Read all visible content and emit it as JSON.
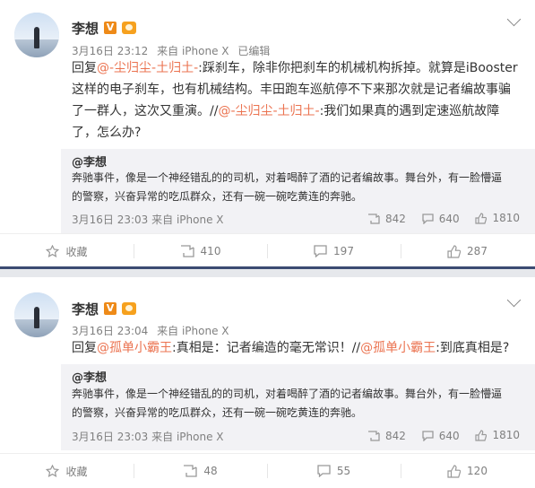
{
  "posts": [
    {
      "username": "李想",
      "meta": {
        "time": "3月16日 23:12",
        "source": "来自 iPhone X",
        "edited": "已编辑"
      },
      "text": {
        "p1": "回复",
        "m1": "@-尘归尘-土归土-",
        "p2": ":踩刹车，除非你把刹车的机械机构拆掉。就算是iBooster这样的电子刹车，也有机械结构。丰田跑车巡航停不下来那次就是记者编故事骗了一群人，这次又重演。",
        "sep": "//",
        "m2": "@-尘归尘-土归土-",
        "p3": ":我们如果真的遇到定速巡航故障了，怎么办?"
      },
      "quote": {
        "user": "@李想",
        "text": "奔驰事件，像是一个神经错乱的的司机，对着喝醉了酒的记者编故事。舞台外，有一脸懵逼的警察，兴奋异常的吃瓜群众，还有一碗一碗吃黄连的奔驰。",
        "time": "3月16日 23:03",
        "source": "来自 iPhone X",
        "shares": "842",
        "comments": "640",
        "likes": "1810"
      },
      "actions": {
        "favorite": "收藏",
        "shares": "410",
        "comments": "197",
        "likes": "287"
      }
    },
    {
      "username": "李想",
      "meta": {
        "time": "3月16日 23:04",
        "source": "来自 iPhone X"
      },
      "text": {
        "p1": "回复",
        "m1": "@孤单小霸王",
        "p2": ":真相是：记者编造的毫无常识！",
        "sep": "//",
        "m2": "@孤单小霸王",
        "p3": ":到底真相是?"
      },
      "quote": {
        "user": "@李想",
        "text": "奔驰事件，像是一个神经错乱的的司机，对着喝醉了酒的记者编故事。舞台外，有一脸懵逼的警察，兴奋异常的吃瓜群众，还有一碗一碗吃黄连的奔驰。",
        "time": "3月16日 23:03",
        "source": "来自 iPhone X",
        "shares": "842",
        "comments": "640",
        "likes": "1810"
      },
      "actions": {
        "favorite": "收藏",
        "shares": "48",
        "comments": "55",
        "likes": "120"
      }
    }
  ],
  "icons": {
    "verified": "verified-v-badge-icon",
    "vip": "vip-crown-icon",
    "more": "chevron-down-icon",
    "favorite": "star-icon",
    "share": "share-icon",
    "comment": "comment-icon",
    "like": "thumbs-up-icon"
  },
  "colors": {
    "mention": "#eb7350",
    "badge": "#ee8a18",
    "meta": "#808080",
    "quote_bg": "#f2f2f5"
  }
}
